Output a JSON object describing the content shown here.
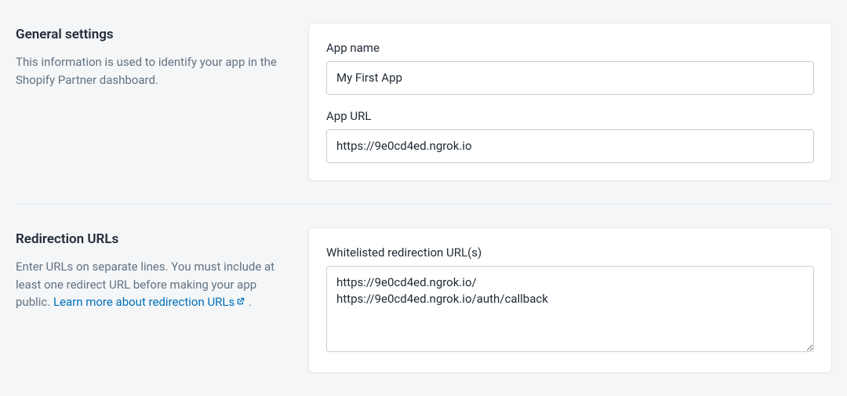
{
  "general": {
    "heading": "General settings",
    "description": "This information is used to identify your app in the Shopify Partner dashboard.",
    "app_name_label": "App name",
    "app_name_value": "My First App",
    "app_url_label": "App URL",
    "app_url_value": "https://9e0cd4ed.ngrok.io"
  },
  "redirection": {
    "heading": "Redirection URLs",
    "description_pre": "Enter URLs on separate lines. You must include at least one redirect URL before making your app public. ",
    "link_text": "Learn more about redirection URLs",
    "description_post": " .",
    "whitelist_label": "Whitelisted redirection URL(s)",
    "whitelist_value": "https://9e0cd4ed.ngrok.io/\nhttps://9e0cd4ed.ngrok.io/auth/callback"
  }
}
